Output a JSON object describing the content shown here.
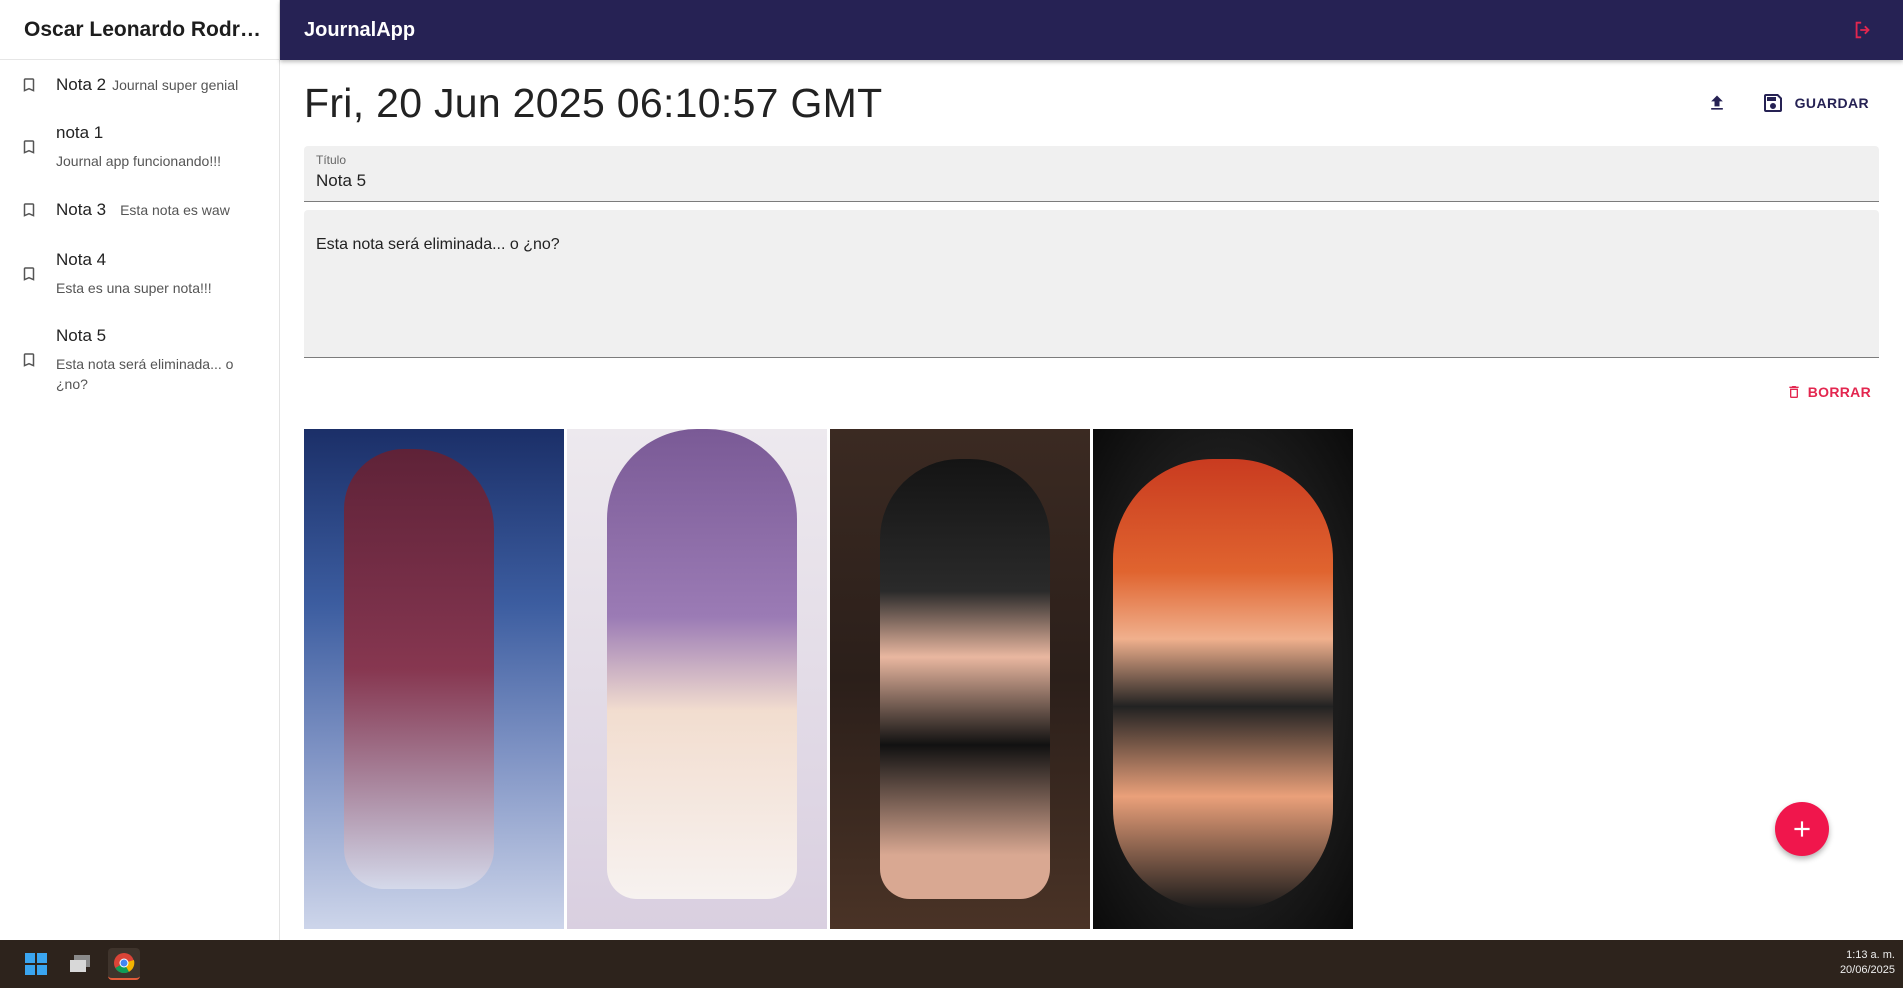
{
  "sidebar": {
    "user_name": "Oscar Leonardo Rodrig...",
    "notes": [
      {
        "title": "Nota 2",
        "body": "Journal super genial"
      },
      {
        "title": "nota 1",
        "body": "Journal app funcionando!!!"
      },
      {
        "title": "Nota 3",
        "body": "Esta nota es waw"
      },
      {
        "title": "Nota 4",
        "body": "Esta es una super nota!!!"
      },
      {
        "title": "Nota 5",
        "body": "Esta nota será eliminada... o ¿no?"
      }
    ]
  },
  "appbar": {
    "brand": "JournalApp",
    "logout_icon": "logout-icon",
    "color": "#262254"
  },
  "editor": {
    "date": "Fri, 20 Jun 2025 06:10:57 GMT",
    "upload_icon": "upload-icon",
    "save_label": "GUARDAR",
    "title_label": "Título",
    "title_value": "Nota 5",
    "body_value": "Esta nota será eliminada... o ¿no?",
    "delete_label": "BORRAR",
    "accent_color": "#e3264f"
  },
  "gallery": {
    "images": [
      "image-1",
      "image-2",
      "image-3",
      "image-4"
    ]
  },
  "fab": {
    "icon": "add-icon",
    "color": "#f0164c"
  },
  "taskbar": {
    "icons": [
      "windows-start-icon",
      "task-view-icon",
      "chrome-icon"
    ],
    "time": "1:13 a. m.",
    "date": "20/06/2025"
  }
}
